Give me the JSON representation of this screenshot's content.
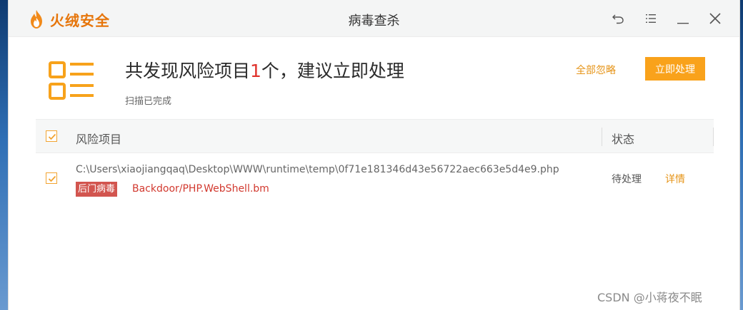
{
  "app": {
    "logo_text": "火绒安全",
    "window_title": "病毒查杀"
  },
  "summary": {
    "headline_prefix": "共发现风险项目",
    "count": "1",
    "headline_suffix": "个，建议立即处理",
    "status_text": "扫描已完成",
    "ignore_all_label": "全部忽略",
    "process_now_label": "立即处理"
  },
  "table": {
    "columns": {
      "risk": "风险项目",
      "status": "状态"
    },
    "rows": [
      {
        "path": "C:\\Users\\xiaojiangqaq\\Desktop\\WWW\\runtime\\temp\\0f71e181346d43e56722aec663e5d4e9.php",
        "tag": "后门病毒",
        "threat": "Backdoor/PHP.WebShell.bm",
        "status": "待处理",
        "detail_label": "详情"
      }
    ]
  },
  "watermark": "CSDN @小蒋夜不眠",
  "colors": {
    "accent_orange": "#f9a21b",
    "threat_red": "#d2392f",
    "tag_bg": "#d2554f"
  }
}
